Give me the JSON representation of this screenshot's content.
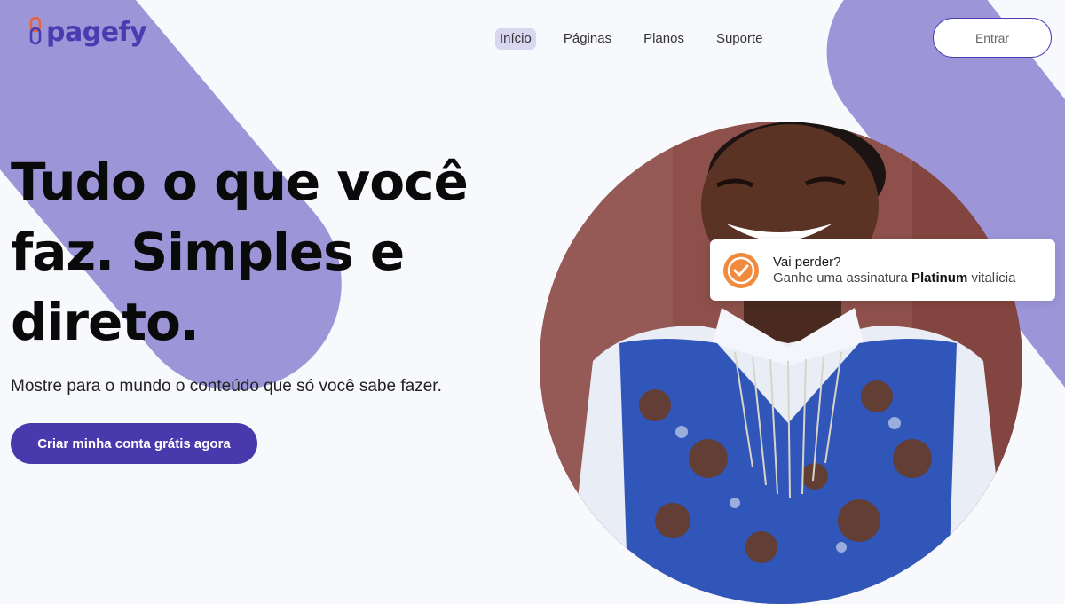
{
  "brand": {
    "name": "pagefy",
    "logo_icon": "link-chain-icon"
  },
  "nav": {
    "items": [
      {
        "label": "Início",
        "active": true
      },
      {
        "label": "Páginas",
        "active": false
      },
      {
        "label": "Planos",
        "active": false
      },
      {
        "label": "Suporte",
        "active": false
      }
    ],
    "login_label": "Entrar"
  },
  "hero": {
    "title_line1": "Tudo o que você",
    "title_line2": "faz. Simples e",
    "title_line3": "direto.",
    "subtitle": "Mostre para o mundo o conteúdo que só você sabe fazer.",
    "cta_label": "Criar minha conta grátis agora",
    "image": "smiling-woman-photo"
  },
  "notice": {
    "icon": "check-circle-icon",
    "title": "Vai perder?",
    "body_prefix": "Ganhe uma assinatura",
    "body_highlight": "Platinum",
    "body_suffix": "vitalícia"
  },
  "colors": {
    "brand_purple": "#4a38ad",
    "blob_lavender": "#9c96d8",
    "accent_orange": "#f08a3c",
    "background": "#f8f9fd"
  }
}
